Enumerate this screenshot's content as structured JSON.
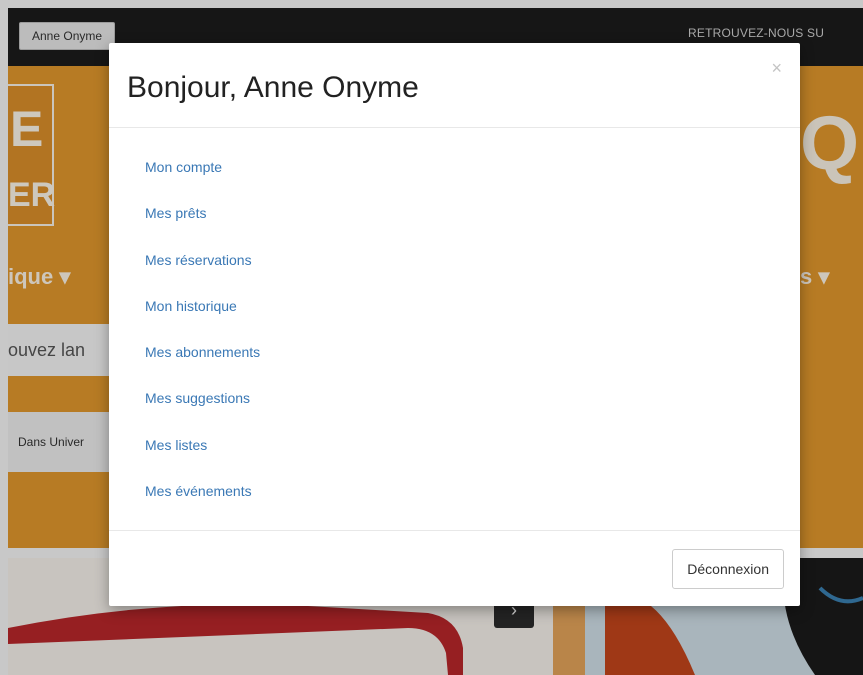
{
  "topbar": {
    "user_button": "Anne Onyme",
    "follow_label": "RETROUVEZ-NOUS SU"
  },
  "background": {
    "logo_letter_top": "E",
    "logo_letter_bottom": "ER",
    "right_letter": "Q",
    "nav_left": "ique ▾",
    "nav_right": "s ▾",
    "search_placeholder": "ouvez lan",
    "scope_label": "Dans Univer",
    "card_arrow": "›",
    "colors": {
      "banner": "#e0962c",
      "topbar": "#1c1c1c"
    }
  },
  "modal": {
    "title": "Bonjour, Anne Onyme",
    "close_glyph": "×",
    "menu_items": [
      {
        "label": "Mon compte"
      },
      {
        "label": "Mes prêts"
      },
      {
        "label": "Mes réservations"
      },
      {
        "label": "Mon historique"
      },
      {
        "label": "Mes abonnements"
      },
      {
        "label": "Mes suggestions"
      },
      {
        "label": "Mes listes"
      },
      {
        "label": "Mes événements"
      }
    ],
    "logout_label": "Déconnexion",
    "link_color": "#3a78b5"
  }
}
